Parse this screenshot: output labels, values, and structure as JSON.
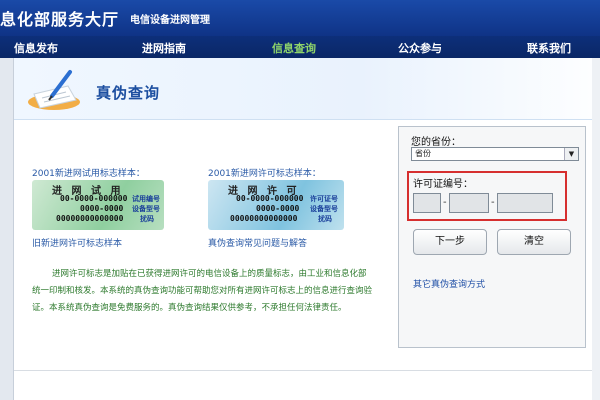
{
  "header": {
    "site_name": "息化部服务大厅",
    "subtitle": "电信设备进网管理"
  },
  "nav": {
    "items": [
      {
        "label": "信息发布"
      },
      {
        "label": "进网指南"
      },
      {
        "label": "信息查询",
        "active": true
      },
      {
        "label": "公众参与"
      },
      {
        "label": "联系我们"
      }
    ]
  },
  "page": {
    "title": "真伪查询",
    "title_icon": "pen-paper-icon"
  },
  "samples": {
    "trial_caption": "2001新进网试用标志样本：",
    "license_caption": "2001新进网许可标志样本：",
    "trial_card": {
      "top": "进 网 试 用",
      "line1": "00-0000-000000",
      "line2": "0000-0000",
      "line3": "00000000000000",
      "label1": "试用编号",
      "label2": "设备型号",
      "label3": "扰码"
    },
    "license_card": {
      "top": "进 网 许 可",
      "line1": "00-0000-000000",
      "line2": "0000-0000",
      "line3": "00000000000000",
      "label1": "许可证号",
      "label2": "设备型号",
      "label3": "扰码"
    },
    "old_sample_link": "旧新进网许可标志样本",
    "faq_link": "真伪查询常见问题与解答"
  },
  "description": "进网许可标志是加贴在已获得进网许可的电信设备上的质量标志，由工业和信息化部统一印制和核发。本系统的真伪查询功能可帮助您对所有进网许可标志上的信息进行查询验证。本系统真伪查询是免费服务的。真伪查询结果仅供参考，不承担任何法律责任。",
  "query": {
    "province_label": "您的省份：",
    "province_value": "省份",
    "license_label": "许可证编号：",
    "seg1": "",
    "seg2": "",
    "seg3": "",
    "next_label": "下一步",
    "clear_label": "清空",
    "other_link": "其它真伪查询方式"
  },
  "colors": {
    "header_blue": "#1a4aa8",
    "nav_active": "#8fd46a",
    "highlight_red": "#d62f2f",
    "desc_green": "#2d7a2d"
  }
}
